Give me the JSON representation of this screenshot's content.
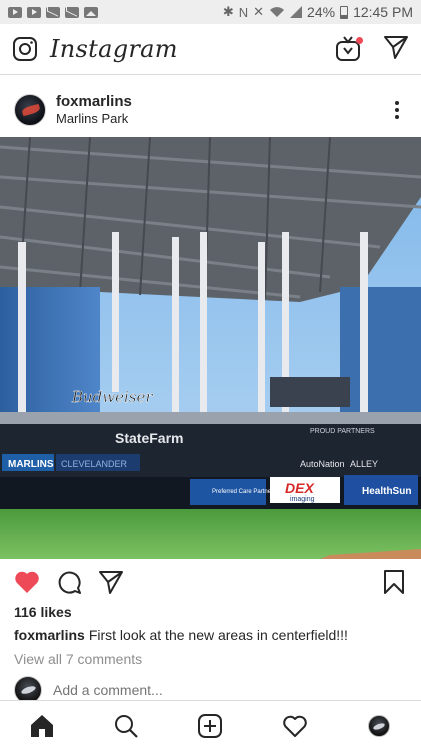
{
  "status_bar": {
    "battery": "24%",
    "time": "12:45 PM"
  },
  "app": {
    "title": "Instagram"
  },
  "post": {
    "username": "foxmarlins",
    "location": "Marlins Park",
    "likes": "116 likes",
    "caption_user": "foxmarlins",
    "caption_text": "First look at the new areas in centerfield!!!",
    "view_comments": "View all 7 comments",
    "add_comment_placeholder": "Add a comment...",
    "photo_signage": {
      "budweiser": "Budweiser",
      "statefarm": "StateFarm",
      "marlins": "MARLINS",
      "cleveland": "CLEVELANDER",
      "proud_partners": "PROUD PARTNERS",
      "autonation": "AutoNation",
      "alley": "ALLEY",
      "preferred": "Preferred Care Partners",
      "dex": "DEX",
      "dex_sub": "imaging",
      "healthsun": "HealthSun"
    }
  },
  "colors": {
    "like_red": "#ed4956",
    "text": "#262626",
    "muted": "#8e8e8e",
    "divider": "#dbdbdb"
  },
  "icons": {
    "camera": "camera-icon",
    "igtv": "igtv-icon",
    "direct": "paper-plane-icon",
    "like": "heart-filled-icon",
    "comment": "comment-bubble-icon",
    "share": "paper-plane-icon",
    "save": "bookmark-icon",
    "home": "home-icon",
    "search": "search-icon",
    "new_post": "plus-square-icon",
    "activity": "heart-outline-icon"
  }
}
